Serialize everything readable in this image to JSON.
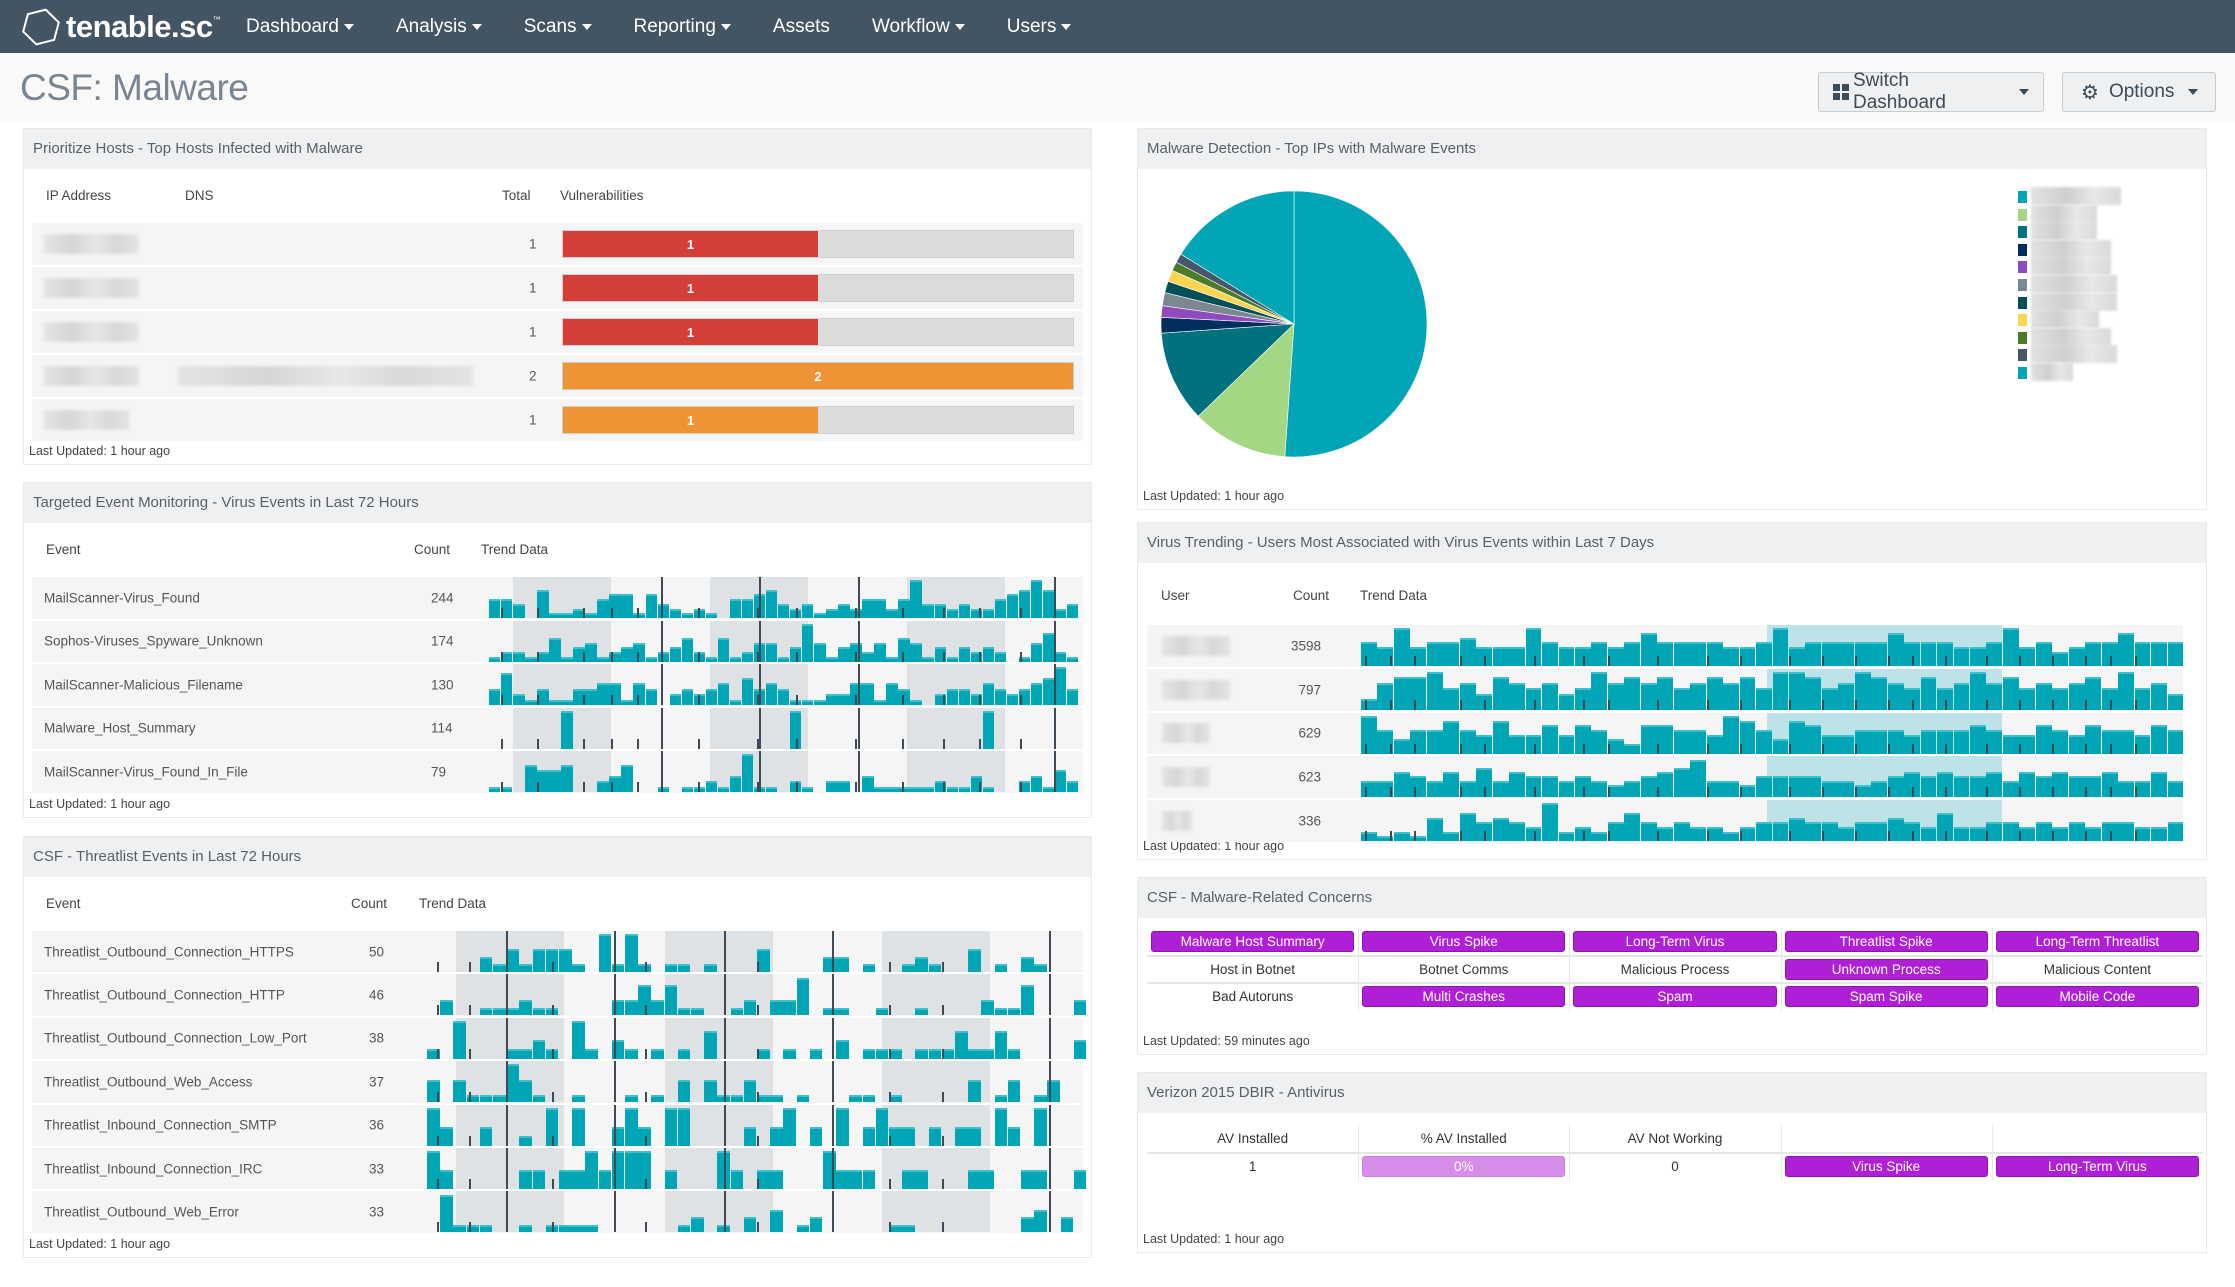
{
  "navbar": {
    "brand": "tenable.sc",
    "menu": [
      {
        "label": "Dashboard",
        "dropdown": true
      },
      {
        "label": "Analysis",
        "dropdown": true
      },
      {
        "label": "Scans",
        "dropdown": true
      },
      {
        "label": "Reporting",
        "dropdown": true
      },
      {
        "label": "Assets",
        "dropdown": false
      },
      {
        "label": "Workflow",
        "dropdown": true
      },
      {
        "label": "Users",
        "dropdown": true
      }
    ]
  },
  "page": {
    "title": "CSF: Malware",
    "switch_dashboard_label": "Switch Dashboard",
    "options_label": "Options"
  },
  "colors": {
    "navbar": "#435463",
    "teal": "#00a6b5",
    "red": "#d43f3a",
    "orange": "#ef9434",
    "purple": "#ae1fd6",
    "purple_light": "#d68ee9"
  },
  "top_hosts": {
    "title": "Prioritize Hosts - Top Hosts Infected with Malware",
    "columns": [
      "IP Address",
      "DNS",
      "Total",
      "Vulnerabilities"
    ],
    "max": 2,
    "rows": [
      {
        "ip": "[redacted]",
        "dns": "",
        "total": "1",
        "vuln": 1,
        "color": "#d43f3a"
      },
      {
        "ip": "[redacted]",
        "dns": "",
        "total": "1",
        "vuln": 1,
        "color": "#d43f3a"
      },
      {
        "ip": "[redacted]",
        "dns": "",
        "total": "1",
        "vuln": 1,
        "color": "#d43f3a"
      },
      {
        "ip": "[redacted]",
        "dns": "[redacted]",
        "total": "2",
        "vuln": 2,
        "color": "#ef9434"
      },
      {
        "ip": "[redacted]",
        "dns": "",
        "total": "1",
        "vuln": 1,
        "color": "#ef9434"
      }
    ],
    "last_updated": "Last Updated: 1 hour ago"
  },
  "virus_events": {
    "title": "Targeted Event Monitoring - Virus Events in Last 72 Hours",
    "columns": [
      "Event",
      "Count",
      "Trend Data"
    ],
    "rows": [
      {
        "event": "MailScanner-Virus_Found",
        "count": "244",
        "trend": [
          4,
          4,
          3,
          0,
          6,
          1,
          1,
          2,
          1,
          4,
          5,
          5,
          1,
          5,
          3,
          2,
          1,
          2,
          1,
          0,
          4,
          4,
          5,
          6,
          3,
          2,
          3,
          1,
          2,
          3,
          2,
          4,
          4,
          2,
          4,
          8,
          3,
          3,
          2,
          3,
          2,
          2,
          4,
          5,
          6,
          8,
          6,
          2,
          3
        ]
      },
      {
        "event": "Sophos-Viruses_Spyware_Unknown",
        "count": "174",
        "trend": [
          1,
          2,
          2,
          1,
          2,
          5,
          1,
          3,
          4,
          1,
          2,
          3,
          4,
          1,
          2,
          3,
          5,
          2,
          1,
          5,
          1,
          2,
          4,
          4,
          1,
          3,
          8,
          4,
          1,
          3,
          4,
          2,
          4,
          1,
          5,
          4,
          1,
          3,
          1,
          3,
          2,
          3,
          2,
          0,
          1,
          4,
          6,
          2,
          1
        ]
      },
      {
        "event": "MailScanner-Malicious_Filename",
        "count": "130",
        "trend": [
          3,
          6,
          2,
          1,
          3,
          1,
          1,
          3,
          3,
          4,
          4,
          1,
          4,
          3,
          0,
          2,
          3,
          2,
          3,
          4,
          1,
          5,
          3,
          4,
          3,
          1,
          1,
          1,
          2,
          2,
          4,
          4,
          1,
          4,
          3,
          1,
          0,
          2,
          3,
          3,
          2,
          4,
          3,
          2,
          3,
          4,
          5,
          7,
          3
        ]
      },
      {
        "event": "Malware_Host_Summary",
        "count": "114",
        "trend": [
          0,
          0,
          0,
          0,
          0,
          0,
          9,
          0,
          0,
          0,
          0,
          0,
          0,
          0,
          0,
          0,
          0,
          0,
          0,
          0,
          0,
          0,
          0,
          0,
          0,
          9,
          0,
          0,
          0,
          0,
          0,
          0,
          0,
          0,
          0,
          0,
          0,
          0,
          0,
          0,
          0,
          9,
          0,
          0,
          0,
          0,
          0,
          0,
          0
        ]
      },
      {
        "event": "MailScanner-Virus_Found_In_File",
        "count": "79",
        "trend": [
          1,
          1,
          0,
          5,
          4,
          4,
          5,
          0,
          0,
          2,
          3,
          5,
          0,
          0,
          1,
          0,
          1,
          1,
          2,
          1,
          3,
          7,
          1,
          1,
          0,
          2,
          1,
          0,
          2,
          2,
          0,
          3,
          1,
          1,
          1,
          1,
          1,
          2,
          1,
          1,
          3,
          1,
          0,
          0,
          2,
          3,
          1,
          4,
          2
        ]
      }
    ],
    "last_updated": "Last Updated: 1 hour ago"
  },
  "threatlist_events": {
    "title": "CSF - Threatlist Events in Last 72 Hours",
    "columns": [
      "Event",
      "Count",
      "Trend Data"
    ],
    "rows": [
      {
        "event": "Threatlist_Outbound_Connection_HTTPS",
        "count": "50",
        "trend": [
          0,
          0,
          0,
          0,
          2,
          1,
          3,
          1,
          3,
          3,
          3,
          1,
          0,
          5,
          1,
          5,
          1,
          0,
          1,
          1,
          0,
          1,
          0,
          0,
          0,
          3,
          0,
          0,
          0,
          0,
          2,
          2,
          0,
          1,
          0,
          0,
          1,
          2,
          1,
          0,
          0,
          3,
          0,
          1,
          0,
          2,
          1,
          0,
          0,
          0
        ]
      },
      {
        "event": "Threatlist_Outbound_Connection_HTTP",
        "count": "46",
        "trend": [
          0,
          2,
          0,
          0,
          1,
          1,
          1,
          2,
          1,
          1,
          0,
          0,
          0,
          0,
          2,
          2,
          4,
          2,
          4,
          1,
          1,
          0,
          0,
          1,
          2,
          0,
          2,
          2,
          5,
          0,
          1,
          1,
          0,
          0,
          1,
          0,
          0,
          1,
          0,
          0,
          0,
          0,
          2,
          1,
          1,
          4,
          0,
          0,
          0,
          2
        ]
      },
      {
        "event": "Threatlist_Outbound_Connection_Low_Port",
        "count": "38",
        "trend": [
          1,
          0,
          4,
          0,
          0,
          0,
          1,
          1,
          2,
          1,
          0,
          4,
          1,
          0,
          2,
          1,
          0,
          1,
          0,
          1,
          0,
          3,
          0,
          0,
          0,
          1,
          0,
          1,
          0,
          1,
          0,
          2,
          0,
          1,
          1,
          1,
          0,
          1,
          1,
          1,
          3,
          1,
          1,
          3,
          1,
          0,
          0,
          0,
          0,
          2
        ]
      },
      {
        "event": "Threatlist_Outbound_Web_Access",
        "count": "37",
        "trend": [
          3,
          0,
          3,
          1,
          1,
          1,
          5,
          3,
          1,
          0,
          0,
          1,
          0,
          0,
          0,
          1,
          0,
          1,
          0,
          3,
          0,
          3,
          1,
          1,
          3,
          1,
          1,
          0,
          1,
          0,
          0,
          0,
          1,
          1,
          0,
          1,
          0,
          0,
          0,
          0,
          0,
          3,
          0,
          1,
          3,
          0,
          1,
          3,
          0,
          0
        ]
      },
      {
        "event": "Threatlist_Inbound_Connection_SMTP",
        "count": "36",
        "trend": [
          4,
          2,
          0,
          0,
          2,
          0,
          0,
          1,
          0,
          4,
          0,
          4,
          0,
          0,
          2,
          4,
          2,
          0,
          4,
          4,
          0,
          0,
          0,
          0,
          2,
          0,
          2,
          4,
          0,
          2,
          0,
          4,
          0,
          2,
          4,
          2,
          2,
          0,
          2,
          0,
          2,
          2,
          0,
          4,
          2,
          0,
          4,
          0,
          0,
          0
        ]
      },
      {
        "event": "Threatlist_Inbound_Connection_IRC",
        "count": "33",
        "trend": [
          4,
          2,
          0,
          0,
          0,
          0,
          0,
          2,
          2,
          0,
          2,
          2,
          4,
          2,
          4,
          4,
          4,
          0,
          2,
          0,
          0,
          0,
          4,
          2,
          0,
          2,
          2,
          0,
          0,
          0,
          4,
          2,
          2,
          2,
          0,
          0,
          2,
          2,
          0,
          0,
          0,
          2,
          2,
          0,
          0,
          2,
          2,
          0,
          0,
          2
        ]
      },
      {
        "event": "Threatlist_Outbound_Web_Error",
        "count": "33",
        "trend": [
          0,
          5,
          1,
          1,
          1,
          0,
          0,
          1,
          0,
          1,
          1,
          1,
          1,
          0,
          0,
          0,
          0,
          0,
          0,
          1,
          2,
          0,
          1,
          0,
          2,
          0,
          3,
          0,
          1,
          2,
          0,
          0,
          0,
          0,
          0,
          1,
          1,
          0,
          0,
          0,
          0,
          0,
          0,
          0,
          0,
          2,
          3,
          0,
          2,
          0
        ]
      }
    ],
    "last_updated": "Last Updated: 1 hour ago"
  },
  "malware_detection": {
    "title": "Malware Detection - Top IPs with Malware Events",
    "last_updated": "Last Updated: 1 hour ago"
  },
  "chart_data": {
    "type": "pie",
    "title": "Malware Detection - Top IPs with Malware Events",
    "legend_position": "right",
    "labels": [
      "[redacted IP 1]",
      "[redacted IP 2]",
      "[redacted IP 3]",
      "[redacted IP 4]",
      "[redacted IP 5]",
      "[redacted IP 6]",
      "[redacted IP 7]",
      "[redacted IP 8]",
      "[redacted IP 9]",
      "[redacted IP 10]",
      "[redacted IP 11]"
    ],
    "values": [
      51.1,
      11.7,
      11.1,
      1.9,
      1.4,
      1.6,
      1.4,
      1.4,
      1.1,
      1.1,
      16.2
    ],
    "unit": "percent (estimated)",
    "colors": [
      "#00a6b5",
      "#a3d784",
      "#00717d",
      "#002e5d",
      "#8e4bbd",
      "#7c8792",
      "#00505a",
      "#fcd44f",
      "#4a7b27",
      "#47566a",
      "#00a6b5"
    ]
  },
  "virus_trending": {
    "title": "Virus Trending - Users Most Associated with Virus Events within Last 7 Days",
    "columns": [
      "User",
      "Count",
      "Trend Data"
    ],
    "rows": [
      {
        "user": "[redacted]",
        "count": "3598",
        "trend": [
          5,
          4,
          8,
          4,
          5,
          5,
          6,
          4,
          4,
          4,
          8,
          5,
          4,
          4,
          5,
          4,
          5,
          7,
          5,
          5,
          5,
          5,
          4,
          4,
          5,
          8,
          4,
          5,
          5,
          5,
          5,
          5,
          7,
          5,
          5,
          5,
          4,
          4,
          5,
          8,
          4,
          5,
          3,
          4,
          5,
          5,
          7,
          5,
          5,
          5
        ]
      },
      {
        "user": "[redacted]",
        "count": "797",
        "trend": [
          2,
          5,
          6,
          6,
          7,
          4,
          5,
          3,
          6,
          5,
          4,
          5,
          3,
          4,
          7,
          5,
          6,
          5,
          6,
          4,
          5,
          6,
          5,
          6,
          4,
          7,
          7,
          6,
          4,
          5,
          7,
          6,
          5,
          4,
          6,
          4,
          5,
          7,
          5,
          6,
          4,
          5,
          4,
          5,
          6,
          4,
          7,
          4,
          5,
          3
        ]
      },
      {
        "user": "[redacted]",
        "count": "629",
        "trend": [
          8,
          5,
          3,
          5,
          5,
          7,
          5,
          4,
          7,
          4,
          4,
          6,
          4,
          6,
          5,
          3,
          2,
          6,
          6,
          5,
          5,
          4,
          8,
          7,
          5,
          3,
          7,
          6,
          4,
          4,
          5,
          5,
          5,
          4,
          5,
          5,
          5,
          6,
          5,
          4,
          4,
          6,
          5,
          4,
          6,
          5,
          5,
          4,
          6,
          5
        ]
      },
      {
        "user": "[redacted]",
        "count": "623",
        "trend": [
          4,
          4,
          6,
          5,
          4,
          6,
          4,
          7,
          4,
          6,
          5,
          5,
          4,
          5,
          4,
          3,
          4,
          5,
          6,
          7,
          9,
          4,
          4,
          3,
          5,
          5,
          5,
          5,
          4,
          4,
          3,
          4,
          5,
          6,
          5,
          6,
          5,
          5,
          6,
          4,
          6,
          5,
          6,
          5,
          5,
          6,
          4,
          4,
          6,
          4
        ]
      },
      {
        "user": "[redacted]",
        "count": "336",
        "trend": [
          2,
          1,
          2,
          1,
          5,
          2,
          6,
          4,
          5,
          4,
          3,
          8,
          2,
          3,
          2,
          4,
          6,
          4,
          3,
          4,
          3,
          3,
          2,
          3,
          4,
          4,
          5,
          4,
          4,
          3,
          4,
          4,
          5,
          4,
          3,
          6,
          3,
          3,
          4,
          4,
          3,
          4,
          3,
          4,
          3,
          4,
          4,
          3,
          3,
          4
        ]
      }
    ],
    "last_updated": "Last Updated: 1 hour ago"
  },
  "concerns": {
    "title": "CSF - Malware-Related Concerns",
    "rows": [
      [
        {
          "label": "Malware Host Summary",
          "active": true
        },
        {
          "label": "Virus Spike",
          "active": true
        },
        {
          "label": "Long-Term Virus",
          "active": true
        },
        {
          "label": "Threatlist Spike",
          "active": true
        },
        {
          "label": "Long-Term Threatlist",
          "active": true
        }
      ],
      [
        {
          "label": "Host in Botnet",
          "active": false
        },
        {
          "label": "Botnet Comms",
          "active": false
        },
        {
          "label": "Malicious Process",
          "active": false
        },
        {
          "label": "Unknown Process",
          "active": true
        },
        {
          "label": "Malicious Content",
          "active": false
        }
      ],
      [
        {
          "label": "Bad Autoruns",
          "active": false
        },
        {
          "label": "Multi Crashes",
          "active": true
        },
        {
          "label": "Spam",
          "active": true
        },
        {
          "label": "Spam Spike",
          "active": true
        },
        {
          "label": "Mobile Code",
          "active": true
        }
      ]
    ],
    "last_updated": "Last Updated: 59 minutes ago"
  },
  "verizon": {
    "title": "Verizon 2015 DBIR - Antivirus",
    "headers": [
      "AV Installed",
      "% AV Installed",
      "AV Not Working",
      "",
      ""
    ],
    "values": {
      "av_installed": "1",
      "pct_av_installed": "0%",
      "pct_av_installed_fraction": 0,
      "av_not_working": "0",
      "badge1": "Virus Spike",
      "badge2": "Long-Term Virus"
    },
    "last_updated": "Last Updated: 1 hour ago"
  }
}
